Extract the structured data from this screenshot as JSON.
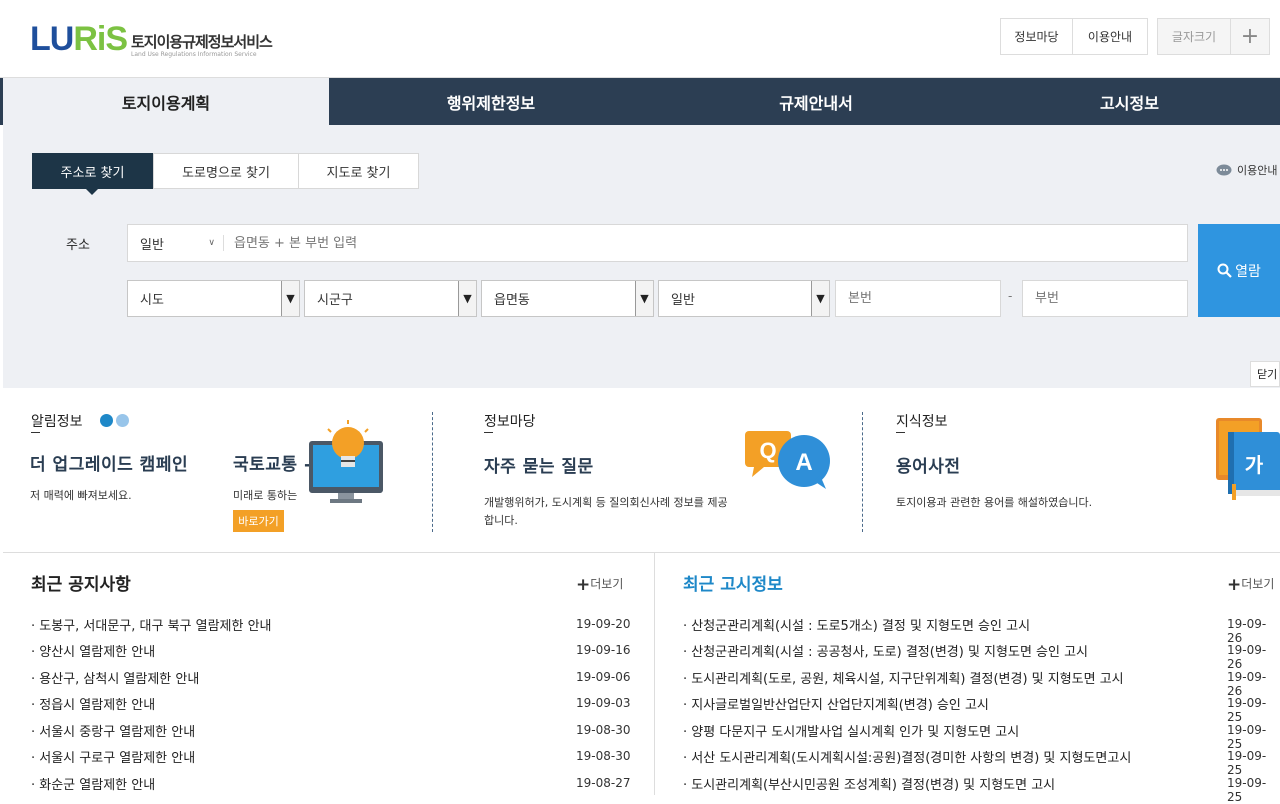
{
  "header": {
    "logo_main": "LU",
    "logo_accent": "RiS",
    "logo_title": "토지이용규제정보서비스",
    "logo_subtitle": "Land Use Regulations Information Service",
    "buttons": {
      "info_madang": "정보마당",
      "guide": "이용안내",
      "font_size": "글자크기",
      "plus": "+"
    }
  },
  "main_tabs": [
    "토지이용계획",
    "행위제한정보",
    "규제안내서",
    "고시정보"
  ],
  "search": {
    "subtabs": [
      "주소로 찾기",
      "도로명으로 찾기",
      "지도로 찾기"
    ],
    "help_link": "이용안내",
    "address_label": "주소",
    "type_select": "일반",
    "address_placeholder": "읍면동 + 본 부번 입력",
    "selects": [
      "시도",
      "시군구",
      "읍면동",
      "일반"
    ],
    "bonbun_placeholder": "본번",
    "dash": "-",
    "bubun_placeholder": "부번",
    "open_button": "열람",
    "close_button": "닫기"
  },
  "info": {
    "notice": {
      "label": "알림정보",
      "title1": "더 업그레이드 캠페인",
      "desc1": "저 매력에 빠져보세요.",
      "title2": "국토교통 -",
      "desc2": "미래로 통하는",
      "go_button": "바로가기"
    },
    "madang": {
      "label": "정보마당",
      "title": "자주 묻는 질문",
      "desc": "개발행위허가, 도시계획 등 질의회신사례 정보를 제공합니다.",
      "icon_q": "Q",
      "icon_a": "A"
    },
    "knowledge": {
      "label": "지식정보",
      "title": "용어사전",
      "desc": "토지이용과 관련한 용어를 해설하였습니다.",
      "icon_text": "가"
    }
  },
  "notices": {
    "title": "최근 공지사항",
    "more": "더보기",
    "items": [
      {
        "text": "도봉구, 서대문구, 대구 북구 열람제한 안내",
        "date": "19-09-20"
      },
      {
        "text": "양산시 열람제한 안내",
        "date": "19-09-16"
      },
      {
        "text": "용산구, 삼척시 열람제한 안내",
        "date": "19-09-06"
      },
      {
        "text": "정읍시 열람제한 안내",
        "date": "19-09-03"
      },
      {
        "text": "서울시 중랑구 열람제한 안내",
        "date": "19-08-30"
      },
      {
        "text": "서울시 구로구 열람제한 안내",
        "date": "19-08-30"
      },
      {
        "text": "화순군 열람제한 안내",
        "date": "19-08-27"
      }
    ]
  },
  "announcements": {
    "title": "최근 고시정보",
    "more": "더보기",
    "items": [
      {
        "text": "산청군관리계획(시설 : 도로5개소) 결정 및 지형도면 승인 고시",
        "date": "19-09-26"
      },
      {
        "text": "산청군관리계획(시설 : 공공청사, 도로) 결정(변경) 및 지형도면 승인 고시",
        "date": "19-09-26"
      },
      {
        "text": "도시관리계획(도로, 공원, 체육시설, 지구단위계획) 결정(변경) 및 지형도면 고시",
        "date": "19-09-26"
      },
      {
        "text": "지사글로벌일반산업단지 산업단지계획(변경) 승인 고시",
        "date": "19-09-25"
      },
      {
        "text": "양평 다문지구 도시개발사업 실시계획 인가 및 지형도면 고시",
        "date": "19-09-25"
      },
      {
        "text": "서산 도시관리계획(도시계획시설:공원)결정(경미한 사항의 변경) 및 지형도면고시",
        "date": "19-09-25"
      },
      {
        "text": "도시관리계획(부산시민공원 조성계획) 결정(변경) 및 지형도면 고시",
        "date": "19-09-25"
      }
    ]
  },
  "colors": {
    "nav_bg": "#2c3e53",
    "active_subtab": "#1d3547",
    "open_button": "#2f95e0",
    "accent_orange": "#f3a026",
    "link_blue": "#1e88c8"
  }
}
